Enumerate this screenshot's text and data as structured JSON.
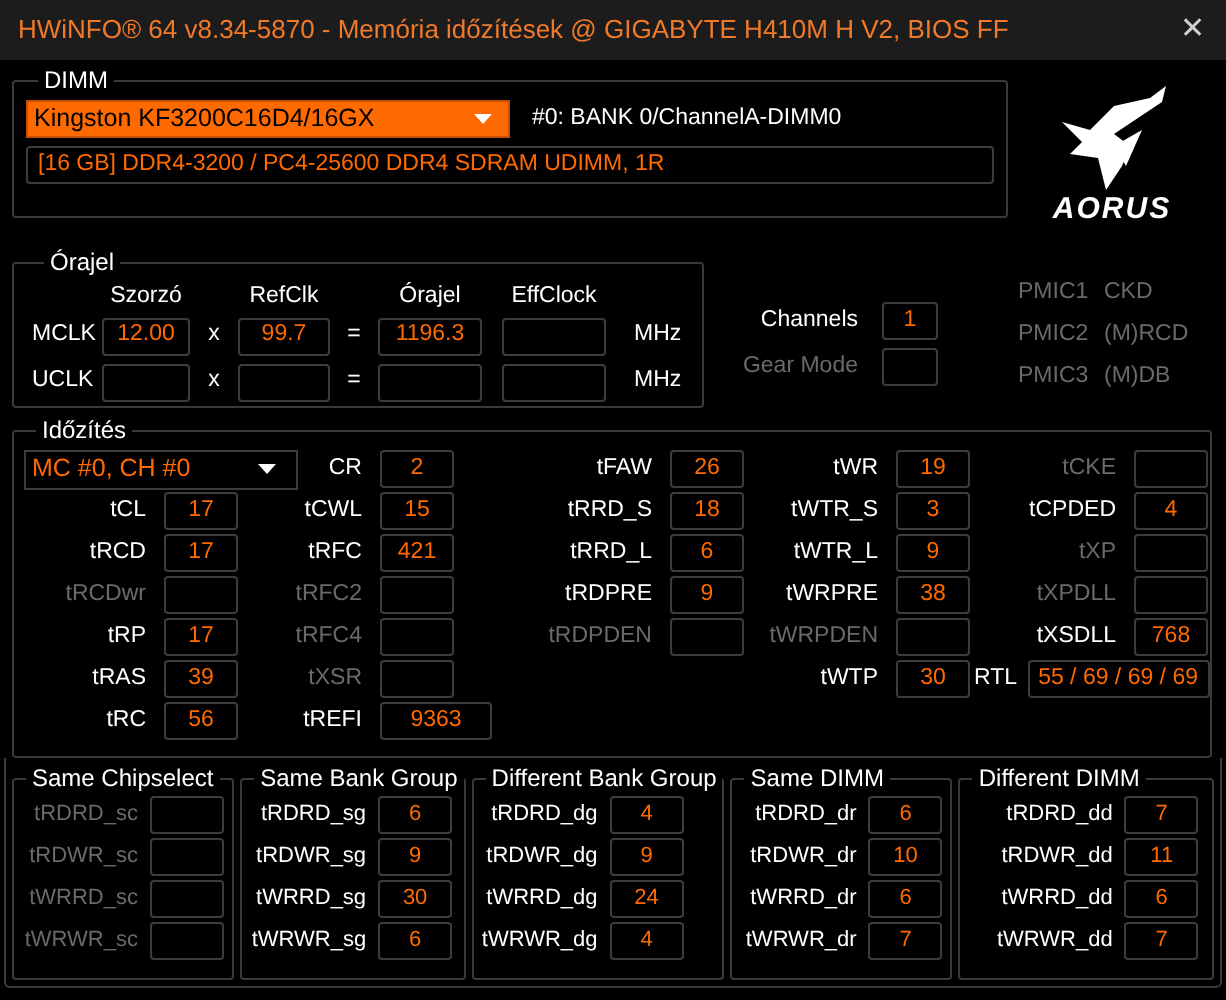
{
  "window": {
    "title": "HWiNFO® 64 v8.34-5870 - Memória időzítések @ GIGABYTE H410M H V2, BIOS FF",
    "close": "✕"
  },
  "dimm": {
    "title": "DIMM",
    "module": "Kingston KF3200C16D4/16GX",
    "slot": "#0: BANK 0/ChannelA-DIMM0",
    "info": "[16 GB] DDR4-3200 / PC4-25600 DDR4 SDRAM UDIMM, 1R"
  },
  "logo": {
    "text": "AORUS"
  },
  "clock": {
    "title": "Órajel",
    "headers": [
      "Szorzó",
      "RefClk",
      "Órajel",
      "EffClock"
    ],
    "rows": [
      {
        "label": "MCLK",
        "multiplier": "12.00",
        "op1": "x",
        "refclk": "99.7",
        "op2": "=",
        "clock": "1196.3",
        "unit": "MHz"
      },
      {
        "label": "UCLK",
        "op1": "x",
        "op2": "=",
        "unit": "MHz"
      }
    ]
  },
  "side": [
    {
      "label": "Channels",
      "value": "1",
      "disabled": false
    },
    {
      "label": "Gear Mode",
      "disabled": true
    }
  ],
  "pmic": [
    {
      "name": "PMIC1",
      "type": "CKD",
      "disabled": true
    },
    {
      "name": "PMIC2",
      "type": "(M)RCD",
      "disabled": true
    },
    {
      "name": "PMIC3",
      "type": "(M)DB",
      "disabled": true
    }
  ],
  "timings": {
    "title": "Időzítés",
    "selector": "MC #0, CH #0",
    "columns": [
      [
        {
          "label": "tCL",
          "value": "17",
          "disabled": false
        },
        {
          "label": "tRCD",
          "value": "17",
          "disabled": false
        },
        {
          "label": "tRCDwr",
          "disabled": true
        },
        {
          "label": "tRP",
          "value": "17",
          "disabled": false
        },
        {
          "label": "tRAS",
          "value": "39",
          "disabled": false
        },
        {
          "label": "tRC",
          "value": "56",
          "disabled": false
        }
      ],
      [
        {
          "label": "CR",
          "value": "2",
          "disabled": false
        },
        {
          "label": "tCWL",
          "value": "15",
          "disabled": false
        },
        {
          "label": "tRFC",
          "value": "421",
          "disabled": false
        },
        {
          "label": "tRFC2",
          "disabled": true
        },
        {
          "label": "tRFC4",
          "disabled": true
        },
        {
          "label": "tXSR",
          "disabled": true
        },
        {
          "label": "tREFI",
          "value": "9363",
          "disabled": false,
          "kind": "wide"
        }
      ],
      [
        {
          "label": "tFAW",
          "value": "26",
          "disabled": false
        },
        {
          "label": "tRRD_S",
          "value": "18",
          "disabled": false
        },
        {
          "label": "tRRD_L",
          "value": "6",
          "disabled": false
        },
        {
          "label": "tRDPRE",
          "value": "9",
          "disabled": false
        },
        {
          "label": "tRDPDEN",
          "disabled": true
        }
      ],
      [
        {
          "label": "tWR",
          "value": "19",
          "disabled": false
        },
        {
          "label": "tWTR_S",
          "value": "3",
          "disabled": false
        },
        {
          "label": "tWTR_L",
          "value": "9",
          "disabled": false
        },
        {
          "label": "tWRPRE",
          "value": "38",
          "disabled": false
        },
        {
          "label": "tWRPDEN",
          "disabled": true
        },
        {
          "label": "tWTP",
          "value": "30",
          "disabled": false
        }
      ],
      [
        {
          "label": "tCKE",
          "disabled": true
        },
        {
          "label": "tCPDED",
          "value": "4",
          "disabled": false
        },
        {
          "label": "tXP",
          "disabled": true
        },
        {
          "label": "tXPDLL",
          "disabled": true
        },
        {
          "label": "tXSDLL",
          "value": "768",
          "disabled": false
        }
      ]
    ],
    "rtl": {
      "label": "RTL",
      "value": "55 / 69 / 69 / 69"
    }
  },
  "groups": [
    {
      "title": "Same Chipselect",
      "items": [
        {
          "label": "tRDRD_sc",
          "disabled": true
        },
        {
          "label": "tRDWR_sc",
          "disabled": true
        },
        {
          "label": "tWRRD_sc",
          "disabled": true
        },
        {
          "label": "tWRWR_sc",
          "disabled": true
        }
      ]
    },
    {
      "title": "Same Bank Group",
      "items": [
        {
          "label": "tRDRD_sg",
          "value": "6",
          "disabled": false
        },
        {
          "label": "tRDWR_sg",
          "value": "9",
          "disabled": false
        },
        {
          "label": "tWRRD_sg",
          "value": "30",
          "disabled": false
        },
        {
          "label": "tWRWR_sg",
          "value": "6",
          "disabled": false
        }
      ]
    },
    {
      "title": "Different Bank Group",
      "items": [
        {
          "label": "tRDRD_dg",
          "value": "4",
          "disabled": false
        },
        {
          "label": "tRDWR_dg",
          "value": "9",
          "disabled": false
        },
        {
          "label": "tWRRD_dg",
          "value": "24",
          "disabled": false
        },
        {
          "label": "tWRWR_dg",
          "value": "4",
          "disabled": false
        }
      ]
    },
    {
      "title": "Same DIMM",
      "items": [
        {
          "label": "tRDRD_dr",
          "value": "6",
          "disabled": false
        },
        {
          "label": "tRDWR_dr",
          "value": "10",
          "disabled": false
        },
        {
          "label": "tWRRD_dr",
          "value": "6",
          "disabled": false
        },
        {
          "label": "tWRWR_dr",
          "value": "7",
          "disabled": false
        }
      ]
    },
    {
      "title": "Different DIMM",
      "items": [
        {
          "label": "tRDRD_dd",
          "value": "7",
          "disabled": false
        },
        {
          "label": "tRDWR_dd",
          "value": "11",
          "disabled": false
        },
        {
          "label": "tWRRD_dd",
          "value": "6",
          "disabled": false
        },
        {
          "label": "tWRWR_dd",
          "value": "7",
          "disabled": false
        }
      ]
    }
  ]
}
